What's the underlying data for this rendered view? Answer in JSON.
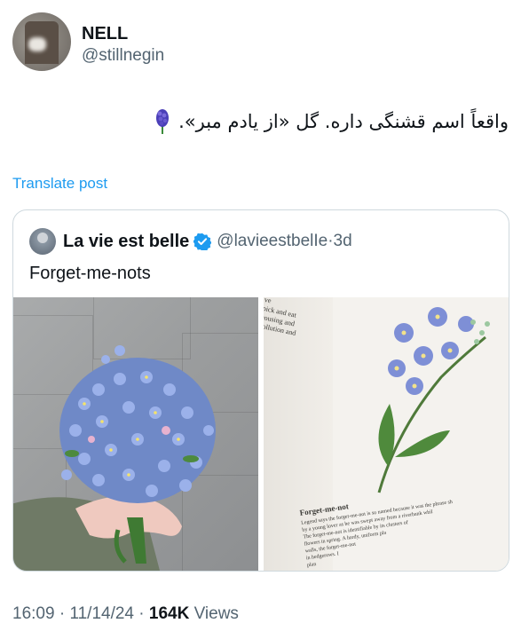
{
  "post": {
    "author_name": "NELL",
    "author_handle": "@stillnegin",
    "text": "واقعاً اسم قشنگی داره. گل «از یادم مبر».",
    "emoji_icon": "hyacinth-icon",
    "translate_label": "Translate post"
  },
  "quote": {
    "name": "La vie est belle",
    "handle": "@lavieestbelIe",
    "separator": "·",
    "time": "3d",
    "text": "Forget-me-nots",
    "book_fragment_top": [
      "ve",
      "pick and eat",
      "housing and",
      "pollution and"
    ],
    "book_heading": "Forget-me-not",
    "book_body": [
      "Legend says the forget-me-not is so named because it was the phrase sh",
      "by a young lover as he was swept away from a riverbank whil",
      "The forget-me-not is identifiable by its clusters of",
      "flowers in spring. A hardy, uniform pla",
      "walls, the forget-me-not",
      "in hedgerows. I",
      "plan"
    ]
  },
  "footer": {
    "time": "16:09",
    "dot1": "·",
    "date": "11/14/24",
    "dot2": "·",
    "views_count": "164K",
    "views_label": "Views"
  },
  "colors": {
    "link": "#1d9bf0",
    "muted": "#536471",
    "text": "#0f1419",
    "verified": "#1d9bf0"
  }
}
